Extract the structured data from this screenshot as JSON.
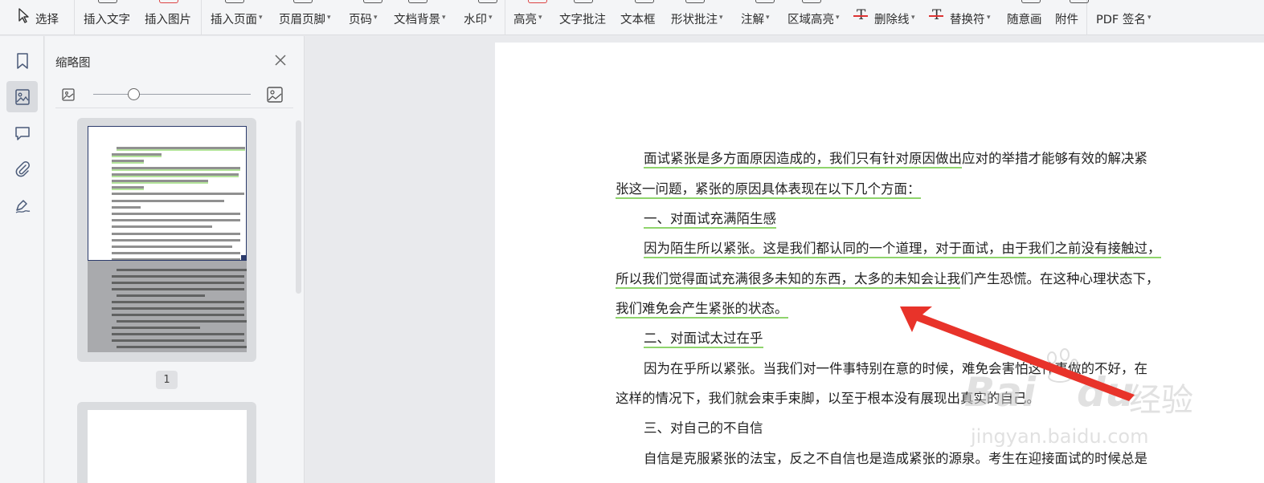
{
  "toolbar": {
    "select_label": "选择",
    "items": [
      {
        "label": "插入文字",
        "caret": ""
      },
      {
        "label": "插入图片",
        "caret": ""
      },
      {
        "label": "插入页面",
        "caret": "▾"
      },
      {
        "label": "页眉页脚",
        "caret": "▾"
      },
      {
        "label": "页码",
        "caret": "▾"
      },
      {
        "label": "文档背景",
        "caret": "▾"
      },
      {
        "label": "水印",
        "caret": "▾"
      },
      {
        "label": "高亮",
        "caret": "▾"
      },
      {
        "label": "文字批注",
        "caret": ""
      },
      {
        "label": "文本框",
        "caret": ""
      },
      {
        "label": "形状批注",
        "caret": "▾"
      },
      {
        "label": "注解",
        "caret": "▾"
      },
      {
        "label": "区域高亮",
        "caret": "▾"
      },
      {
        "label": "删除线",
        "caret": "▾"
      },
      {
        "label": "替换符",
        "caret": "▾"
      },
      {
        "label": "随意画",
        "caret": ""
      },
      {
        "label": "附件",
        "caret": ""
      },
      {
        "label": "PDF 签名",
        "caret": "▾"
      }
    ]
  },
  "rail": {
    "icons": [
      "bookmark-icon",
      "thumbnail-icon",
      "comment-icon",
      "attachment-icon",
      "signature-icon"
    ],
    "active": "thumbnail-icon"
  },
  "panel": {
    "title": "缩略图",
    "zoom_level": 0.17,
    "page_label": "1"
  },
  "document": {
    "paragraphs": [
      {
        "segments": [
          {
            "t": "面试紧张是多方面原因造成的，我们只有针对原因做出",
            "u": true
          },
          {
            "t": "应对的举措才能够有效的解决紧",
            "u": false
          }
        ]
      },
      {
        "segments": [
          {
            "t": "张这一问题，紧张的原因具体表现在以下几个方面：",
            "u": true
          }
        ]
      },
      {
        "segments": [
          {
            "t": "一、对面试充满陌生感",
            "u": true
          }
        ]
      },
      {
        "segments": [
          {
            "t": "因为陌生所以紧张。这是我们都认同的一个道理，对于面试，由于我们之前没有接触过，",
            "u": true
          }
        ]
      },
      {
        "segments": [
          {
            "t": "所以我们觉得面试充满很多未知的东西，太多的未知会让我",
            "u": true
          },
          {
            "t": "们产生恐慌。在这种心理状态下，",
            "u": false
          }
        ]
      },
      {
        "segments": [
          {
            "t": "我们难免会产生紧张的状态。",
            "u": true
          }
        ]
      },
      {
        "segments": [
          {
            "t": "二、对面试太过在乎",
            "u": true
          }
        ]
      },
      {
        "segments": [
          {
            "t": "因为在乎所以紧张。当我们对一件事特别在意的时候，难免会害怕这件事做的不好，在",
            "u": false
          }
        ]
      },
      {
        "segments": [
          {
            "t": "这样的情况下，我们就会束手束脚，以至于根本没有展现出真实的自己。",
            "u": false
          }
        ]
      },
      {
        "segments": [
          {
            "t": "三、对自己的不自信",
            "u": false
          }
        ]
      },
      {
        "segments": [
          {
            "t": "自信是克服紧张的法宝，反之不自信也是造成紧张的源泉。考生在迎接面试的时候总是",
            "u": false
          }
        ]
      }
    ]
  },
  "watermark": {
    "brand": "Bai",
    "brand2": "du",
    "cn": "经验",
    "url": "jingyan.baidu.com"
  },
  "colors": {
    "underline": "#8fd46c",
    "arrow": "#e8332a",
    "thumb_frame": "#2b3a6b"
  }
}
